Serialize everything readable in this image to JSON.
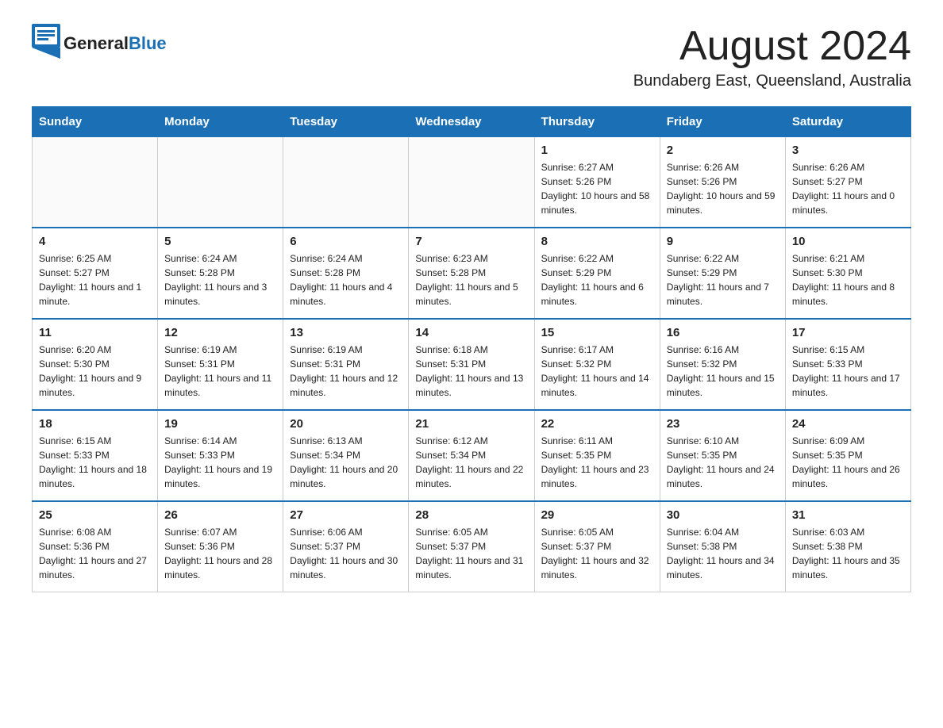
{
  "header": {
    "logo_general": "General",
    "logo_blue": "Blue",
    "month_title": "August 2024",
    "location": "Bundaberg East, Queensland, Australia"
  },
  "columns": [
    "Sunday",
    "Monday",
    "Tuesday",
    "Wednesday",
    "Thursday",
    "Friday",
    "Saturday"
  ],
  "weeks": [
    [
      {
        "day": "",
        "sunrise": "",
        "sunset": "",
        "daylight": ""
      },
      {
        "day": "",
        "sunrise": "",
        "sunset": "",
        "daylight": ""
      },
      {
        "day": "",
        "sunrise": "",
        "sunset": "",
        "daylight": ""
      },
      {
        "day": "",
        "sunrise": "",
        "sunset": "",
        "daylight": ""
      },
      {
        "day": "1",
        "sunrise": "Sunrise: 6:27 AM",
        "sunset": "Sunset: 5:26 PM",
        "daylight": "Daylight: 10 hours and 58 minutes."
      },
      {
        "day": "2",
        "sunrise": "Sunrise: 6:26 AM",
        "sunset": "Sunset: 5:26 PM",
        "daylight": "Daylight: 10 hours and 59 minutes."
      },
      {
        "day": "3",
        "sunrise": "Sunrise: 6:26 AM",
        "sunset": "Sunset: 5:27 PM",
        "daylight": "Daylight: 11 hours and 0 minutes."
      }
    ],
    [
      {
        "day": "4",
        "sunrise": "Sunrise: 6:25 AM",
        "sunset": "Sunset: 5:27 PM",
        "daylight": "Daylight: 11 hours and 1 minute."
      },
      {
        "day": "5",
        "sunrise": "Sunrise: 6:24 AM",
        "sunset": "Sunset: 5:28 PM",
        "daylight": "Daylight: 11 hours and 3 minutes."
      },
      {
        "day": "6",
        "sunrise": "Sunrise: 6:24 AM",
        "sunset": "Sunset: 5:28 PM",
        "daylight": "Daylight: 11 hours and 4 minutes."
      },
      {
        "day": "7",
        "sunrise": "Sunrise: 6:23 AM",
        "sunset": "Sunset: 5:28 PM",
        "daylight": "Daylight: 11 hours and 5 minutes."
      },
      {
        "day": "8",
        "sunrise": "Sunrise: 6:22 AM",
        "sunset": "Sunset: 5:29 PM",
        "daylight": "Daylight: 11 hours and 6 minutes."
      },
      {
        "day": "9",
        "sunrise": "Sunrise: 6:22 AM",
        "sunset": "Sunset: 5:29 PM",
        "daylight": "Daylight: 11 hours and 7 minutes."
      },
      {
        "day": "10",
        "sunrise": "Sunrise: 6:21 AM",
        "sunset": "Sunset: 5:30 PM",
        "daylight": "Daylight: 11 hours and 8 minutes."
      }
    ],
    [
      {
        "day": "11",
        "sunrise": "Sunrise: 6:20 AM",
        "sunset": "Sunset: 5:30 PM",
        "daylight": "Daylight: 11 hours and 9 minutes."
      },
      {
        "day": "12",
        "sunrise": "Sunrise: 6:19 AM",
        "sunset": "Sunset: 5:31 PM",
        "daylight": "Daylight: 11 hours and 11 minutes."
      },
      {
        "day": "13",
        "sunrise": "Sunrise: 6:19 AM",
        "sunset": "Sunset: 5:31 PM",
        "daylight": "Daylight: 11 hours and 12 minutes."
      },
      {
        "day": "14",
        "sunrise": "Sunrise: 6:18 AM",
        "sunset": "Sunset: 5:31 PM",
        "daylight": "Daylight: 11 hours and 13 minutes."
      },
      {
        "day": "15",
        "sunrise": "Sunrise: 6:17 AM",
        "sunset": "Sunset: 5:32 PM",
        "daylight": "Daylight: 11 hours and 14 minutes."
      },
      {
        "day": "16",
        "sunrise": "Sunrise: 6:16 AM",
        "sunset": "Sunset: 5:32 PM",
        "daylight": "Daylight: 11 hours and 15 minutes."
      },
      {
        "day": "17",
        "sunrise": "Sunrise: 6:15 AM",
        "sunset": "Sunset: 5:33 PM",
        "daylight": "Daylight: 11 hours and 17 minutes."
      }
    ],
    [
      {
        "day": "18",
        "sunrise": "Sunrise: 6:15 AM",
        "sunset": "Sunset: 5:33 PM",
        "daylight": "Daylight: 11 hours and 18 minutes."
      },
      {
        "day": "19",
        "sunrise": "Sunrise: 6:14 AM",
        "sunset": "Sunset: 5:33 PM",
        "daylight": "Daylight: 11 hours and 19 minutes."
      },
      {
        "day": "20",
        "sunrise": "Sunrise: 6:13 AM",
        "sunset": "Sunset: 5:34 PM",
        "daylight": "Daylight: 11 hours and 20 minutes."
      },
      {
        "day": "21",
        "sunrise": "Sunrise: 6:12 AM",
        "sunset": "Sunset: 5:34 PM",
        "daylight": "Daylight: 11 hours and 22 minutes."
      },
      {
        "day": "22",
        "sunrise": "Sunrise: 6:11 AM",
        "sunset": "Sunset: 5:35 PM",
        "daylight": "Daylight: 11 hours and 23 minutes."
      },
      {
        "day": "23",
        "sunrise": "Sunrise: 6:10 AM",
        "sunset": "Sunset: 5:35 PM",
        "daylight": "Daylight: 11 hours and 24 minutes."
      },
      {
        "day": "24",
        "sunrise": "Sunrise: 6:09 AM",
        "sunset": "Sunset: 5:35 PM",
        "daylight": "Daylight: 11 hours and 26 minutes."
      }
    ],
    [
      {
        "day": "25",
        "sunrise": "Sunrise: 6:08 AM",
        "sunset": "Sunset: 5:36 PM",
        "daylight": "Daylight: 11 hours and 27 minutes."
      },
      {
        "day": "26",
        "sunrise": "Sunrise: 6:07 AM",
        "sunset": "Sunset: 5:36 PM",
        "daylight": "Daylight: 11 hours and 28 minutes."
      },
      {
        "day": "27",
        "sunrise": "Sunrise: 6:06 AM",
        "sunset": "Sunset: 5:37 PM",
        "daylight": "Daylight: 11 hours and 30 minutes."
      },
      {
        "day": "28",
        "sunrise": "Sunrise: 6:05 AM",
        "sunset": "Sunset: 5:37 PM",
        "daylight": "Daylight: 11 hours and 31 minutes."
      },
      {
        "day": "29",
        "sunrise": "Sunrise: 6:05 AM",
        "sunset": "Sunset: 5:37 PM",
        "daylight": "Daylight: 11 hours and 32 minutes."
      },
      {
        "day": "30",
        "sunrise": "Sunrise: 6:04 AM",
        "sunset": "Sunset: 5:38 PM",
        "daylight": "Daylight: 11 hours and 34 minutes."
      },
      {
        "day": "31",
        "sunrise": "Sunrise: 6:03 AM",
        "sunset": "Sunset: 5:38 PM",
        "daylight": "Daylight: 11 hours and 35 minutes."
      }
    ]
  ]
}
